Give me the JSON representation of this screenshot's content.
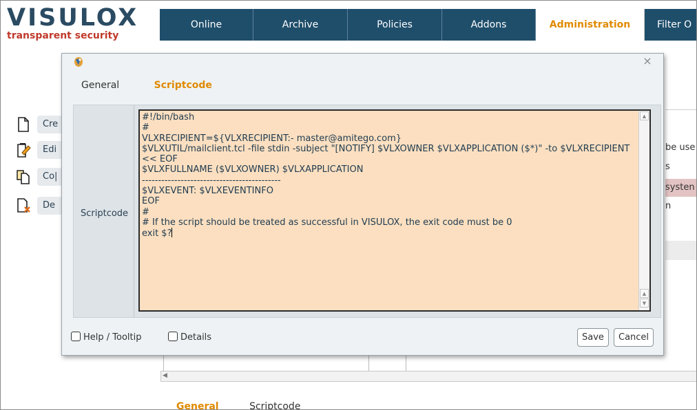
{
  "logo": {
    "name": "VISULOX",
    "tagline": "transparent security"
  },
  "topnav": {
    "tabs": [
      {
        "label": "Online"
      },
      {
        "label": "Archive"
      },
      {
        "label": "Policies"
      },
      {
        "label": "Addons"
      },
      {
        "label": "Administration",
        "active": true
      },
      {
        "label": "Filter O"
      }
    ]
  },
  "background": {
    "tools": [
      {
        "label": "Cre",
        "icon": "new-document-icon"
      },
      {
        "label": "Edi",
        "icon": "edit-document-icon"
      },
      {
        "label": "Co|",
        "icon": "copy-document-icon"
      },
      {
        "label": "De",
        "icon": "delete-document-icon"
      }
    ],
    "right_rows": [
      "be use",
      "s",
      "systen",
      "n"
    ],
    "bottom_tabs": {
      "general": "General",
      "scriptcode": "Scriptcode"
    }
  },
  "dialog": {
    "tabs": {
      "general": "General",
      "scriptcode": "Scriptcode"
    },
    "field_label": "Scriptcode",
    "code": "#!/bin/bash\n#\nVLXRECIPIENT=${VLXRECIPIENT:- master@amitego.com}\n$VLXUTIL/mailclient.tcl -file stdin -subject \"[NOTIFY] $VLXOWNER $VLXAPPLICATION ($*)\" -to $VLXRECIPIENT << EOF\n$VLXFULLNAME ($VLXOWNER) $VLXAPPLICATION\n-------------------------------------------\n$VLXEVENT: $VLXEVENTINFO\nEOF\n#\n# If the script should be treated as successful in VISULOX, the exit code must be 0\nexit $?",
    "help_tooltip_label": "Help / Tooltip",
    "details_label": "Details",
    "save_label": "Save",
    "cancel_label": "Cancel"
  },
  "colors": {
    "nav_bg": "#1f4e6b",
    "accent": "#e08a00",
    "editor_bg": "#fbdfc0",
    "logo_blue": "#2b4b62",
    "logo_red": "#c0392b"
  }
}
